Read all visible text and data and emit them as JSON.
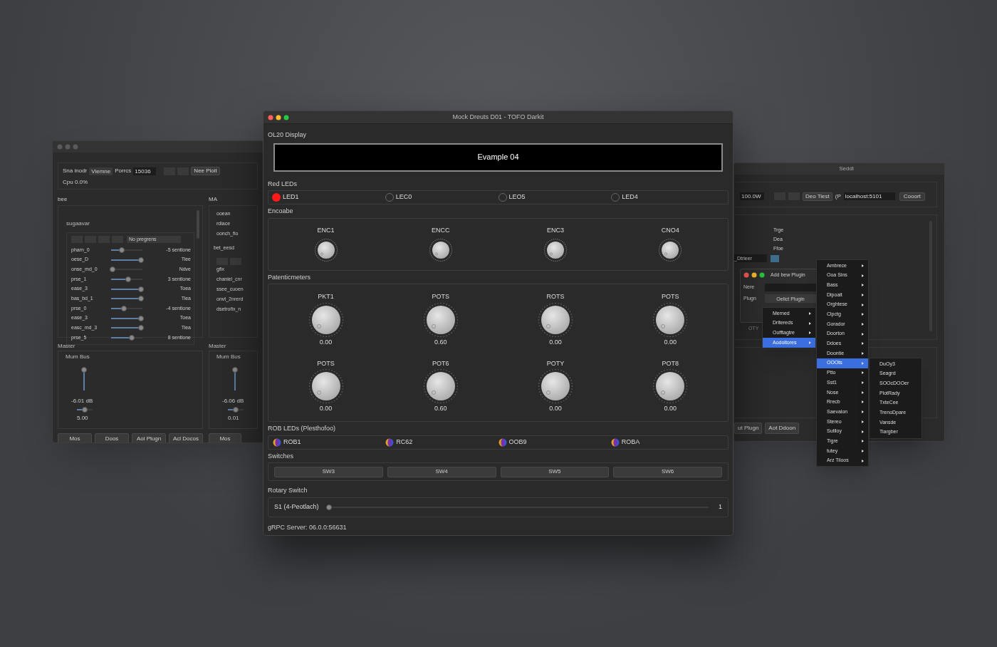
{
  "left_window": {
    "toolbar": {
      "mode_label": "Sna inodr",
      "mode_value": "Viemne",
      "port_label": "Porrcs",
      "port_value": "15036",
      "button": "Nee Pioit",
      "cpu": "Cpu 0.0%"
    },
    "left_panel": {
      "title": "bee",
      "group": "sugaavar",
      "preset": "No pregrens",
      "params": [
        {
          "name": "pharn_0",
          "level": 0.35,
          "value": "-5 sentlone"
        },
        {
          "name": "oese_D",
          "level": 0.95,
          "value": "Tiee"
        },
        {
          "name": "onse_md_0",
          "level": 0.04,
          "value": "Ndve"
        },
        {
          "name": "prse_1",
          "level": 0.55,
          "value": "3 sentlone"
        },
        {
          "name": "ease_3",
          "level": 0.95,
          "value": "Toea"
        },
        {
          "name": "bas_bd_1",
          "level": 0.95,
          "value": "Tiea"
        },
        {
          "name": "prse_0",
          "level": 0.4,
          "value": "-4 sentlone"
        },
        {
          "name": "ease_3",
          "level": 0.95,
          "value": "Toea"
        },
        {
          "name": "easc_md_3",
          "level": 0.95,
          "value": "Tiea"
        },
        {
          "name": "prse_5",
          "level": 0.65,
          "value": "8 sentlone"
        }
      ]
    },
    "master": {
      "title": "Master",
      "bus": "Mum Bus",
      "fader": {
        "level": 0.9
      },
      "reading": "-6.01 dB",
      "pan": {
        "level": 0.5
      },
      "pan_value": "5.00"
    },
    "buttons": [
      "Mos",
      "Doos",
      "Aol Plugn",
      "Acl Docos"
    ],
    "right_panel": {
      "title": "MA",
      "items": [
        "ooean",
        "rdiace",
        "oonch_fio"
      ],
      "group": "bet_eesd",
      "group_items": [
        "gfix",
        "chaniel_cnr",
        "ssee_cuoen",
        "onvt_2nrerd",
        "dsetrofix_n"
      ],
      "master": {
        "title": "Master",
        "bus": "Mum Bus",
        "fader": {
          "level": 0.9
        },
        "reading": "-6.06 dB",
        "pan": {
          "level": 0.5
        },
        "pan_value": "0.01"
      },
      "buttons": [
        "Mos"
      ]
    }
  },
  "main_window": {
    "title": "Mock Dreuts D01 - TOFO Darkit",
    "display": {
      "title": "OL20 Display",
      "text": "Evample 04"
    },
    "red_leds": {
      "title": "Red LEDs",
      "items": [
        {
          "label": "LED1",
          "on": true
        },
        {
          "label": "LEC0",
          "on": false
        },
        {
          "label": "LEO5",
          "on": false
        },
        {
          "label": "LED4",
          "on": false
        }
      ]
    },
    "encoders": {
      "title": "Encoabe",
      "items": [
        "ENC1",
        "ENCC",
        "ENC3",
        "CNO4"
      ]
    },
    "potentiometers": {
      "title": "Patenticmeters",
      "items": [
        {
          "label": "PKT1",
          "value": "0.00"
        },
        {
          "label": "POTS",
          "value": "0.60"
        },
        {
          "label": "ROTS",
          "value": "0.00"
        },
        {
          "label": "POTS",
          "value": "0.00"
        },
        {
          "label": "POTS",
          "value": "0.00"
        },
        {
          "label": "POT6",
          "value": "0.60"
        },
        {
          "label": "POTY",
          "value": "0.00"
        },
        {
          "label": "POT8",
          "value": "0.00"
        }
      ]
    },
    "rgb_leds": {
      "title": "ROB LEDs (Plesthofoo)",
      "items": [
        "ROB1",
        "RC62",
        "OOB9",
        "ROBA"
      ]
    },
    "switches": {
      "title": "Switches",
      "items": [
        "SW3",
        "SW4",
        "SW5",
        "SW6"
      ]
    },
    "rotary": {
      "title": "Rotary Switch",
      "label": "S1 (4-Peotlach)",
      "level": 0,
      "value": "1"
    },
    "status": "gRPC Server: 06.0.0:56631"
  },
  "right_window": {
    "title": "Seddl",
    "toolbar": {
      "value": "100.0W",
      "button": "Deo Tiest",
      "ip_label": "(P",
      "address": "localhost:5101",
      "connect": "Cooort"
    },
    "list": [
      "Trge",
      "Dea",
      "Ffoe"
    ],
    "field": "_Dtrieer",
    "label": "OTY",
    "buttons": [
      "ut Plugn",
      "Aot Ddoon"
    ],
    "dialog": {
      "title": "Add bew Plugin",
      "name_label": "Nere",
      "plugin_label": "Plugn",
      "plugin_value": "Oelict Plugin"
    }
  },
  "menus": [
    {
      "arrows": true,
      "items": [
        {
          "label": "Merned",
          "selected": false
        },
        {
          "label": "Dritereds",
          "selected": false
        },
        {
          "label": "Oofftagtre",
          "selected": false
        },
        {
          "label": "Aodoitores",
          "selected": true
        }
      ]
    },
    {
      "arrows": true,
      "items": [
        {
          "label": "Ambrece",
          "selected": false
        },
        {
          "label": "Ooa Sins",
          "selected": false
        },
        {
          "label": "Bass",
          "selected": false
        },
        {
          "label": "Dlpoait",
          "selected": false
        },
        {
          "label": "Orghtese",
          "selected": false
        },
        {
          "label": "Clpctg",
          "selected": false
        },
        {
          "label": "Gorador",
          "selected": false
        },
        {
          "label": "Doorton",
          "selected": false
        },
        {
          "label": "Ddoes",
          "selected": false
        },
        {
          "label": "Doontie",
          "selected": false
        },
        {
          "label": "OOOts",
          "selected": true
        },
        {
          "label": "Ptto",
          "selected": false
        },
        {
          "label": "Sst1",
          "selected": false
        },
        {
          "label": "Nose",
          "selected": false
        },
        {
          "label": "Rrecb",
          "selected": false
        },
        {
          "label": "Saevalon",
          "selected": false
        },
        {
          "label": "Stereo",
          "selected": false
        },
        {
          "label": "Sutiloy",
          "selected": false
        },
        {
          "label": "Tigre",
          "selected": false
        },
        {
          "label": "tutey",
          "selected": false
        },
        {
          "label": "Arz Tiloos",
          "selected": false
        }
      ]
    },
    {
      "arrows": false,
      "items": [
        {
          "label": "DuOy3",
          "selected": false
        },
        {
          "label": "Seagrd",
          "selected": false
        },
        {
          "label": "SOOcDOOer",
          "selected": false
        },
        {
          "label": "PlotRady",
          "selected": false
        },
        {
          "label": "TxteCee",
          "selected": false
        },
        {
          "label": "TrenoDpare",
          "selected": false
        },
        {
          "label": "Vansde",
          "selected": false
        },
        {
          "label": "Tiargber",
          "selected": false
        }
      ]
    }
  ]
}
